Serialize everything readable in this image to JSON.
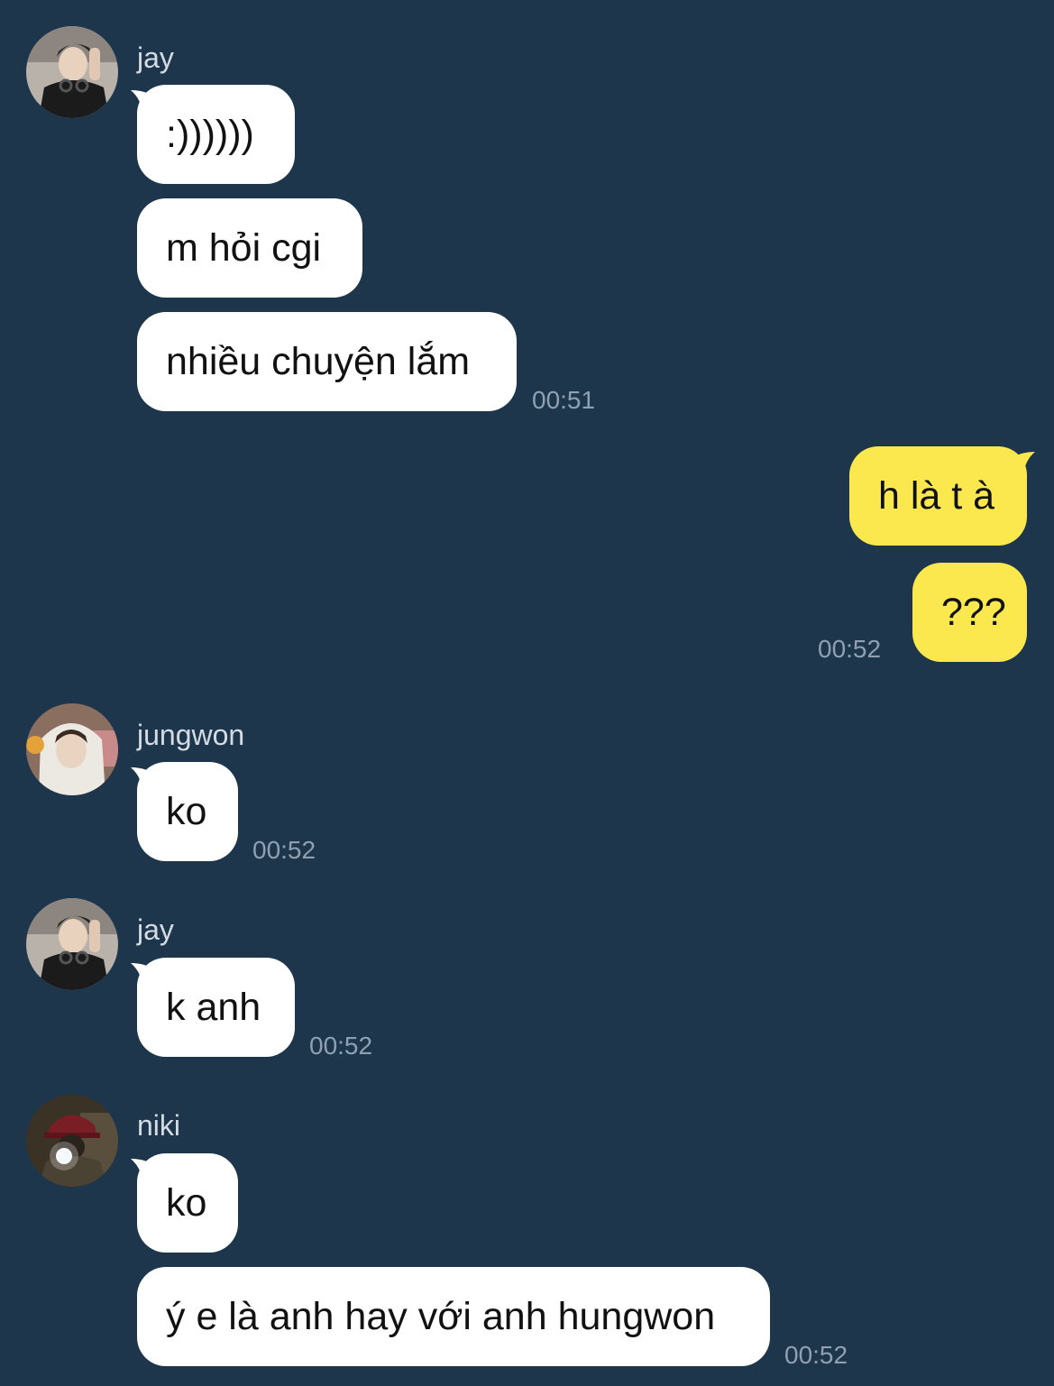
{
  "colors": {
    "background": "#1d364b",
    "incoming_bubble": "#ffffff",
    "outgoing_bubble": "#fbe84f",
    "timestamp": "#8fa0b2",
    "sender_name": "#d4dbe3"
  },
  "messages": [
    {
      "sender": "jay",
      "avatar": "jay-avatar-icon",
      "bubbles": [
        ":))))))",
        "m hỏi cgi",
        "nhiều chuyện lắm"
      ],
      "time": "00:51"
    },
    {
      "sender": "me",
      "bubbles": [
        "h là t à",
        "???"
      ],
      "time": "00:52"
    },
    {
      "sender": "jungwon",
      "avatar": "jungwon-avatar-icon",
      "bubbles": [
        "ko"
      ],
      "time": "00:52"
    },
    {
      "sender": "jay",
      "avatar": "jay-avatar-icon",
      "bubbles": [
        "k anh"
      ],
      "time": "00:52"
    },
    {
      "sender": "niki",
      "avatar": "niki-avatar-icon",
      "bubbles": [
        "ko",
        "ý e là anh hay với anh hungwon"
      ],
      "time": "00:52"
    }
  ]
}
